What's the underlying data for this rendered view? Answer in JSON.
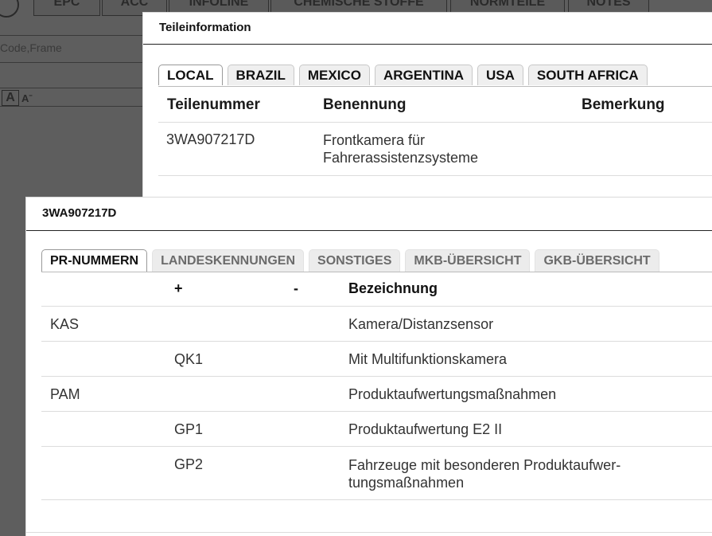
{
  "background": {
    "tabs": [
      "EPC",
      "ACC",
      "INFOLINE",
      "CHEMISCHE STOFFE",
      "NORMTEILE",
      "NOTES"
    ],
    "search_placeholder": "Code,Frame",
    "font_increase": "A",
    "font_decrease": "Aˉ"
  },
  "teileinfo": {
    "title": "Teileinformation",
    "tabs": [
      "LOCAL",
      "BRAZIL",
      "MEXICO",
      "ARGENTINA",
      "USA",
      "SOUTH AFRICA"
    ],
    "columns": [
      "Teilenummer",
      "Benennung",
      "Bemerkung"
    ],
    "rows": [
      {
        "teilenummer": "3WA907217D",
        "benennung": "Frontkamera für Fahrerassistenzsysteme",
        "bemerkung": ""
      }
    ]
  },
  "part_detail": {
    "title": "3WA907217D",
    "tabs": [
      "PR-NUMMERN",
      "LANDESKENNUNGEN",
      "SONSTIGES",
      "MKB-ÜBERSICHT",
      "GKB-ÜBERSICHT"
    ],
    "columns": [
      "",
      "+",
      "-",
      "Bezeichnung"
    ],
    "rows": [
      {
        "family": "KAS",
        "plus": "",
        "minus": "",
        "bezeichnung": "Kamera/Distanzsensor"
      },
      {
        "family": "",
        "plus": "QK1",
        "minus": "",
        "bezeichnung": "Mit Multifunktionskamera"
      },
      {
        "family": "PAM",
        "plus": "",
        "minus": "",
        "bezeichnung": "Produktaufwertungsmaßnahmen"
      },
      {
        "family": "",
        "plus": "GP1",
        "minus": "",
        "bezeichnung": "Produktaufwertung E2 II"
      },
      {
        "family": "",
        "plus": "GP2",
        "minus": "",
        "bezeichnung": "Fahrzeuge mit besonderen Produktaufwer-tungsmaßnahmen"
      }
    ]
  }
}
